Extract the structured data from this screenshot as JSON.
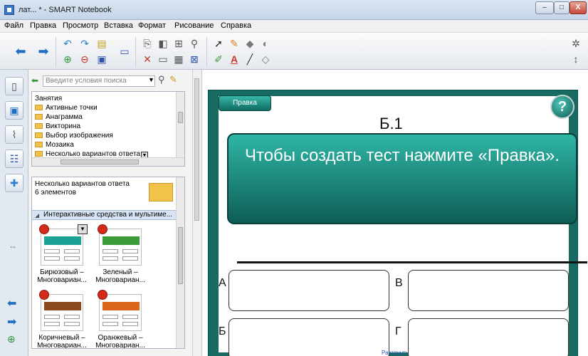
{
  "window": {
    "title": "лат... * - SMART Notebook",
    "controls": [
      "–",
      "□",
      "X"
    ]
  },
  "menubar": [
    "Файл",
    "Правка",
    "Просмотр",
    "Вставка",
    "Формат",
    "Рисование",
    "Справка"
  ],
  "gallery": {
    "search_placeholder": "Введите условия поиска",
    "tree": [
      "Занятия",
      "Активные точки",
      "Анаграмма",
      "Викторина",
      "Выбор изображения",
      "Мозаика",
      "Несколько вариантов ответа"
    ],
    "selected_tree_index": 6,
    "info_title": "Несколько вариантов ответа",
    "info_count": "6 элементов",
    "section_header": "Интерактивные средства и мультиме...",
    "thumbnails": [
      {
        "label_line1": "Бирюзовый –",
        "label_line2": "Многовариан...",
        "color": "#1aa395"
      },
      {
        "label_line1": "Зеленый –",
        "label_line2": "Многовариан...",
        "color": "#3b9b3b"
      },
      {
        "label_line1": "Коричневый –",
        "label_line2": "Многовариан...",
        "color": "#8b4a1c"
      },
      {
        "label_line1": "Оранжевый –",
        "label_line2": "Многовариан...",
        "color": "#d9661a"
      }
    ]
  },
  "slide": {
    "edit_tab": "Правка",
    "title": "Б.1",
    "help": "?",
    "question": "Чтобы создать тест нажмите «Правка».",
    "answers": [
      "А",
      "В",
      "Б",
      "Г"
    ]
  },
  "bottom_link": "Растянуть",
  "colors": {
    "accent_teal": "#176b63",
    "selection_blue": "#3399ff"
  }
}
